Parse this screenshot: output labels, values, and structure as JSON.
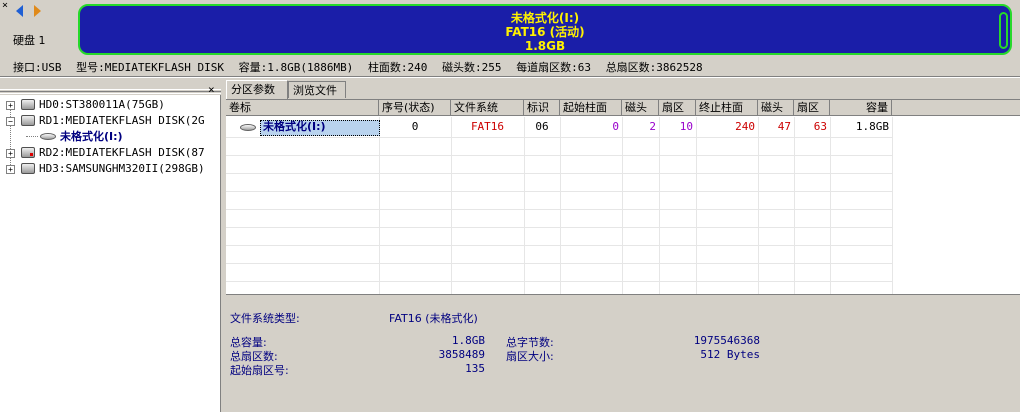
{
  "disk_bar": {
    "close_glyph": "×",
    "disk_label": "硬盘 1",
    "partition": {
      "name": "未格式化(I:)",
      "fs_line": "FAT16 (活动)",
      "size": "1.8GB"
    },
    "info": {
      "interface": "接口:USB",
      "model": "型号:MEDIATEKFLASH DISK",
      "capacity": "容量:1.8GB(1886MB)",
      "cylinders": "柱面数:240",
      "heads": "磁头数:255",
      "sectors_per_track": "每道扇区数:63",
      "total_sectors": "总扇区数:3862528"
    }
  },
  "tree": {
    "close_glyph": "×",
    "items": [
      {
        "label": "HD0:ST380011A(75GB)"
      },
      {
        "label": "RD1:MEDIATEKFLASH DISK(2G"
      },
      {
        "label": "未格式化(I:)"
      },
      {
        "label": "RD2:MEDIATEKFLASH DISK(87"
      },
      {
        "label": "HD3:SAMSUNGHM320II(298GB)"
      }
    ]
  },
  "tabs": [
    {
      "label": "分区参数",
      "active": true
    },
    {
      "label": "浏览文件",
      "active": false
    }
  ],
  "table": {
    "headers": [
      "卷标",
      "序号(状态)",
      "文件系统",
      "标识",
      "起始柱面",
      "磁头",
      "扇区",
      "终止柱面",
      "磁头",
      "扇区",
      "容量"
    ],
    "rows": [
      {
        "volume": "未格式化(I:)",
        "index": "0",
        "fs": "FAT16",
        "id": "06",
        "start_cyl": "0",
        "start_head": "2",
        "start_sector": "10",
        "end_cyl": "240",
        "end_head": "47",
        "end_sector": "63",
        "capacity": "1.8GB"
      }
    ]
  },
  "details": {
    "fs_type_label": "文件系统类型:",
    "fs_type_value": "FAT16 (未格式化)",
    "total_capacity_label": "总容量:",
    "total_capacity_value": "1.8GB",
    "total_sectors_label": "总扇区数:",
    "total_sectors_value": "3858489",
    "start_sector_label": "起始扇区号:",
    "start_sector_value": "135",
    "total_bytes_label": "总字节数:",
    "total_bytes_value": "1975546368",
    "sector_size_label": "扇区大小:",
    "sector_size_value": "512 Bytes"
  },
  "colors": {
    "partition_fill": "#1a1ea8",
    "partition_border": "#26d92a",
    "partition_text": "#fff200",
    "red_value": "#cc0000",
    "purple_value": "#9900cc",
    "navy_text": "#000080"
  }
}
